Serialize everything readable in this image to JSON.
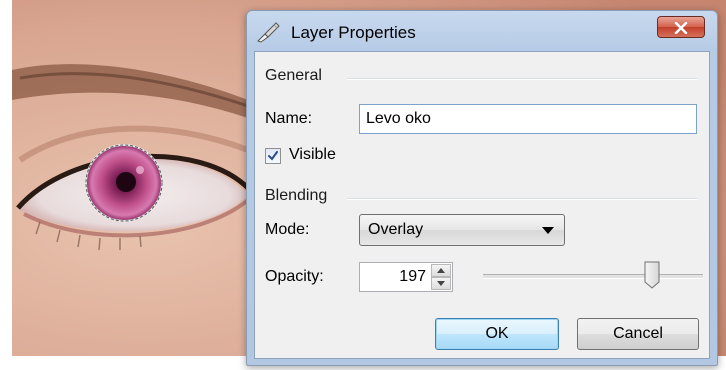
{
  "window": {
    "title": "Layer Properties",
    "close_label": "x"
  },
  "general": {
    "heading": "General",
    "name_label": "Name:",
    "name_value": "Levo oko",
    "visible_label": "Visible",
    "visible_checked": true
  },
  "blending": {
    "heading": "Blending",
    "mode_label": "Mode:",
    "mode_value": "Overlay",
    "opacity_label": "Opacity:",
    "opacity_value": "197",
    "opacity_fraction": 0.77
  },
  "buttons": {
    "ok_label": "OK",
    "cancel_label": "Cancel"
  },
  "colors": {
    "titlebar": "#b6cbe6",
    "client": "#f0f0f0",
    "close_button": "#c2402b",
    "iris": "#c0508a"
  },
  "icons": {
    "title": "paintbrush-icon",
    "close": "close-icon",
    "check": "checkmark-icon",
    "dropdown": "chevron-down-icon",
    "spin_up": "spin-up-icon",
    "spin_down": "spin-down-icon"
  }
}
